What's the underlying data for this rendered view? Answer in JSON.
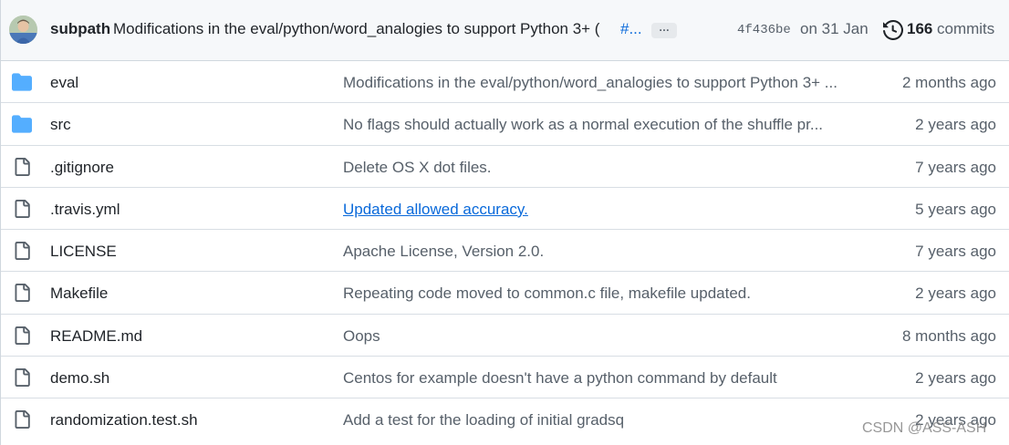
{
  "header": {
    "author": "subpath",
    "commit_message": "Modifications in the eval/python/word_analogies to support Python 3+ (",
    "commit_pr": "#...",
    "ellipsis": "…",
    "sha": "4f436be",
    "date": "on 31 Jan",
    "commits_count": "166",
    "commits_label": "commits"
  },
  "files": [
    {
      "type": "folder",
      "name": "eval",
      "message": "Modifications in the eval/python/word_analogies to support Python 3+ ...",
      "age": "2 months ago",
      "link": false
    },
    {
      "type": "folder",
      "name": "src",
      "message": "No flags should actually work as a normal execution of the shuffle pr...",
      "age": "2 years ago",
      "link": false
    },
    {
      "type": "file",
      "name": ".gitignore",
      "message": "Delete OS X dot files.",
      "age": "7 years ago",
      "link": false
    },
    {
      "type": "file",
      "name": ".travis.yml",
      "message": "Updated allowed accuracy.",
      "age": "5 years ago",
      "link": true
    },
    {
      "type": "file",
      "name": "LICENSE",
      "message": "Apache License, Version 2.0.",
      "age": "7 years ago",
      "link": false
    },
    {
      "type": "file",
      "name": "Makefile",
      "message": "Repeating code moved to common.c file, makefile updated.",
      "age": "2 years ago",
      "link": false
    },
    {
      "type": "file",
      "name": "README.md",
      "message": "Oops",
      "age": "8 months ago",
      "link": false
    },
    {
      "type": "file",
      "name": "demo.sh",
      "message": "Centos for example doesn't have a python command by default",
      "age": "2 years ago",
      "link": false
    },
    {
      "type": "file",
      "name": "randomization.test.sh",
      "message": "Add a test for the loading of initial gradsq",
      "age": "2 years ago",
      "link": false
    }
  ],
  "watermark": "CSDN @ASS-ASH",
  "colors": {
    "folder": "#54aeff",
    "file_icon": "#57606a",
    "link": "#0969da",
    "muted": "#57606a",
    "header_bg": "#f6f8fa",
    "border": "#d0d7de"
  }
}
